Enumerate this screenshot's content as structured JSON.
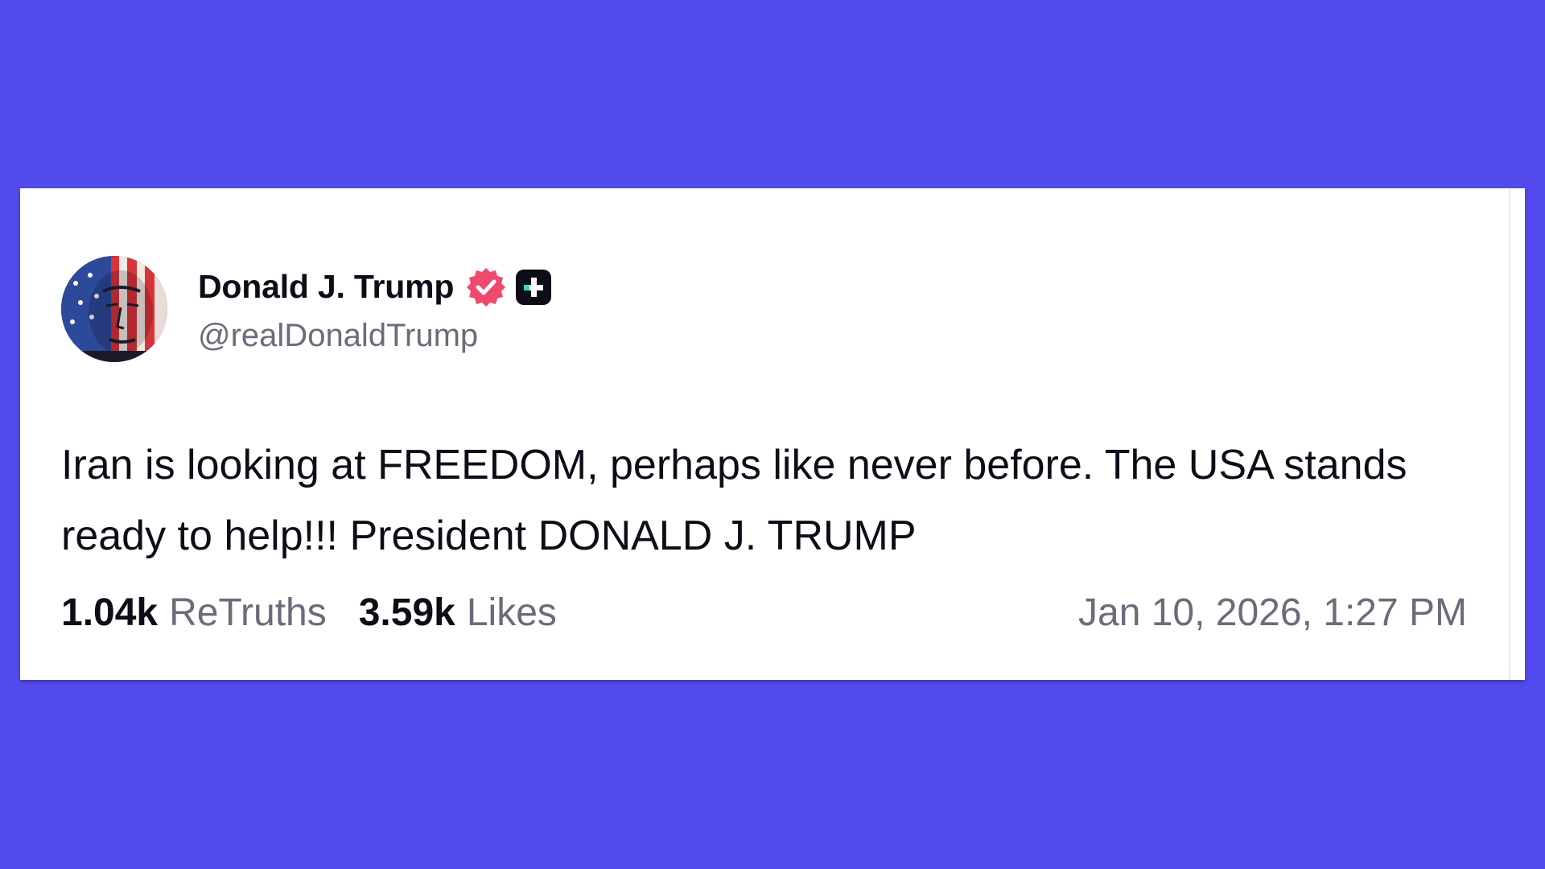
{
  "post": {
    "author": {
      "display_name": "Donald J. Trump",
      "handle": "@realDonaldTrump",
      "verified": true,
      "avatar_icon": "avatar-flag-face-icon"
    },
    "badges": {
      "verified_icon": "verified-badge-icon",
      "verified_color": "#ef4a6e",
      "plus_icon": "plus-badge-icon"
    },
    "text": "Iran is looking at FREEDOM, perhaps like never before. The USA stands ready to help!!! President DONALD J. TRUMP",
    "stats": {
      "retruths_count": "1.04k",
      "retruths_label": "ReTruths",
      "likes_count": "3.59k",
      "likes_label": "Likes"
    },
    "timestamp": "Jan 10, 2026, 1:27 PM"
  },
  "colors": {
    "background": "#544bef",
    "card": "#ffffff",
    "primary_text": "#0e0d17",
    "secondary_text": "#6b6b7a"
  }
}
